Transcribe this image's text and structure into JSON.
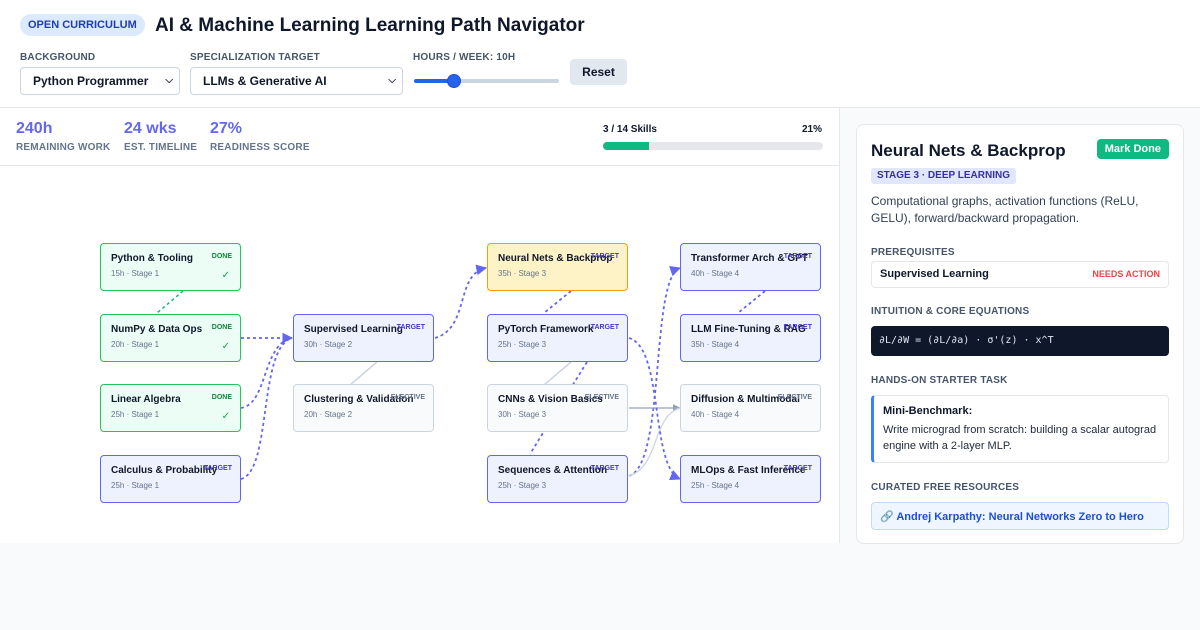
{
  "header": {
    "badge": "OPEN CURRICULUM",
    "title": "AI & Machine Learning Learning Path Navigator",
    "background_label": "BACKGROUND",
    "background_value": "Python Programmer",
    "target_label": "SPECIALIZATION TARGET",
    "target_value": "LLMs & Generative AI",
    "hours_label": "HOURS / WEEK: 10H",
    "hours_value": 10,
    "hours_max": 40,
    "reset_label": "Reset"
  },
  "stats": [
    {
      "value": "240h",
      "label": "REMAINING WORK"
    },
    {
      "value": "24 wks",
      "label": "EST. TIMELINE"
    },
    {
      "value": "27%",
      "label": "READINESS SCORE"
    }
  ],
  "progress": {
    "label": "3 / 14 Skills",
    "percent_text": "21%",
    "fraction": 0.21
  },
  "nodes": [
    {
      "id": "python",
      "title": "Python & Tooling",
      "sub": "15h · Stage 1",
      "tag": "DONE",
      "state": "done",
      "check": "✓"
    },
    {
      "id": "numpy",
      "title": "NumPy & Data Ops",
      "sub": "20h · Stage 1",
      "tag": "DONE",
      "state": "done",
      "check": "✓"
    },
    {
      "id": "linalg",
      "title": "Linear Algebra",
      "sub": "25h · Stage 1",
      "tag": "DONE",
      "state": "done",
      "check": "✓"
    },
    {
      "id": "calculus",
      "title": "Calculus & Probability",
      "sub": "25h · Stage 1",
      "tag": "TARGET",
      "state": "target",
      "check": ""
    },
    {
      "id": "supervised",
      "title": "Supervised Learning",
      "sub": "30h · Stage 2",
      "tag": "TARGET",
      "state": "target",
      "check": ""
    },
    {
      "id": "clustering",
      "title": "Clustering & Validation",
      "sub": "20h · Stage 2",
      "tag": "ELECTIVE",
      "state": "elective",
      "check": ""
    },
    {
      "id": "neural",
      "title": "Neural Nets & Backprop",
      "sub": "35h · Stage 3",
      "tag": "TARGET",
      "state": "selected",
      "check": ""
    },
    {
      "id": "pytorch",
      "title": "PyTorch Framework",
      "sub": "25h · Stage 3",
      "tag": "TARGET",
      "state": "target",
      "check": ""
    },
    {
      "id": "cnn",
      "title": "CNNs & Vision Basics",
      "sub": "30h · Stage 3",
      "tag": "ELECTIVE",
      "state": "elective",
      "check": ""
    },
    {
      "id": "sequences",
      "title": "Sequences & Attention",
      "sub": "25h · Stage 3",
      "tag": "TARGET",
      "state": "target",
      "check": ""
    },
    {
      "id": "transformer",
      "title": "Transformer Arch & GPT",
      "sub": "40h · Stage 4",
      "tag": "TARGET",
      "state": "target",
      "check": ""
    },
    {
      "id": "finetune",
      "title": "LLM Fine-Tuning & RAG",
      "sub": "35h · Stage 4",
      "tag": "TARGET",
      "state": "target",
      "check": ""
    },
    {
      "id": "diffusion",
      "title": "Diffusion & Multimodal",
      "sub": "40h · Stage 4",
      "tag": "ELECTIVE",
      "state": "elective",
      "check": ""
    },
    {
      "id": "mlops",
      "title": "MLOps & Fast Inference",
      "sub": "25h · Stage 4",
      "tag": "TARGET",
      "state": "target",
      "check": ""
    }
  ],
  "detail": {
    "title": "Neural Nets & Backprop",
    "mark_done_label": "Mark Done",
    "stage": "STAGE 3 · DEEP LEARNING",
    "description": "Computational graphs, activation functions (ReLU, GELU), forward/backward propagation.",
    "prereq_label": "PREREQUISITES",
    "prereq_name": "Supervised Learning",
    "prereq_status": "NEEDS ACTION",
    "equations_label": "INTUITION & CORE EQUATIONS",
    "equation": "∂L/∂W = (∂L/∂a) · σ'(z) · x^T",
    "task_label": "HANDS-ON STARTER TASK",
    "task_title": "Mini-Benchmark:",
    "task_desc": "Write micrograd from scratch: building a scalar autograd engine with a 2-layer MLP.",
    "resources_label": "CURATED FREE RESOURCES",
    "resource": "🔗 Andrej Karpathy: Neural Networks Zero to Hero"
  },
  "colors": {
    "accent": "#6366f1",
    "done": "#22c55e",
    "selected": "#f59e0b",
    "progress": "#10b981",
    "needs_action": "#ef4444"
  }
}
